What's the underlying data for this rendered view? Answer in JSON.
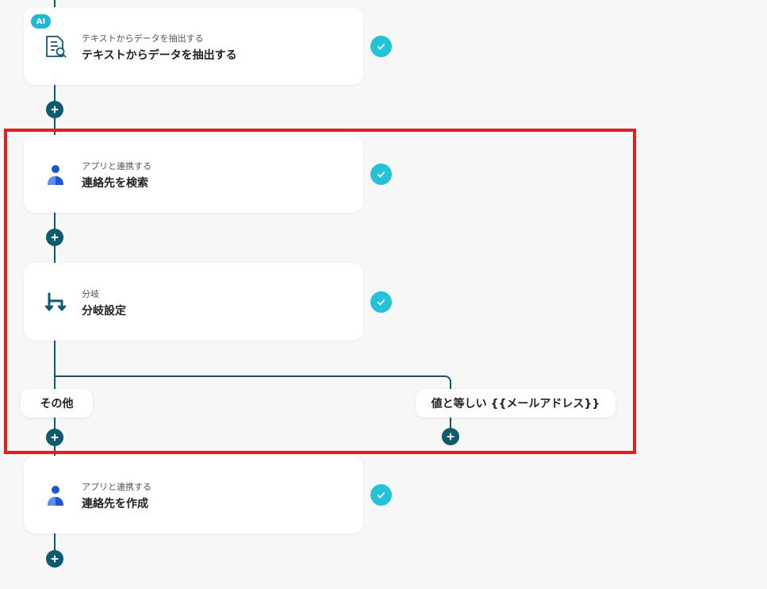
{
  "steps": [
    {
      "badge": "AI",
      "subtitle": "テキストからデータを抽出する",
      "title": "テキストからデータを抽出する",
      "icon": "document-search-icon"
    },
    {
      "subtitle": "アプリと連携する",
      "title": "連絡先を検索",
      "icon": "person-icon"
    },
    {
      "subtitle": "分岐",
      "title": "分岐設定",
      "icon": "branch-icon"
    },
    {
      "subtitle": "アプリと連携する",
      "title": "連絡先を作成",
      "icon": "person-icon"
    }
  ],
  "branches": {
    "left_label": "その他",
    "right_label": "値と等しい {{メールアドレス}}"
  },
  "colors": {
    "line": "#0e5a70",
    "check": "#22c3d9",
    "highlight": "#e02020",
    "ai_badge": "#1fb8d6"
  }
}
